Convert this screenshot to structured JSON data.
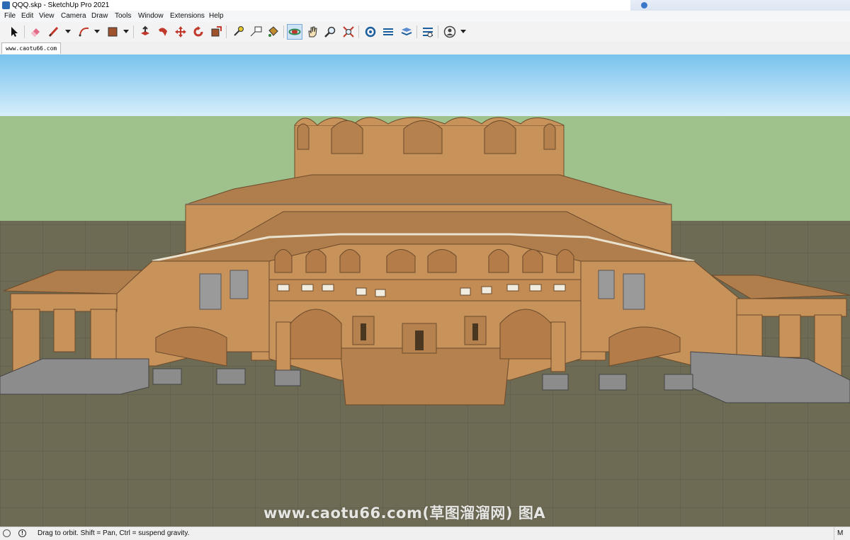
{
  "window": {
    "title": "QQQ.skp - SketchUp Pro 2021"
  },
  "menu": [
    "File",
    "Edit",
    "View",
    "Camera",
    "Draw",
    "Tools",
    "Window",
    "Extensions",
    "Help"
  ],
  "toolbar": {
    "tools": [
      {
        "name": "select-icon"
      },
      {
        "name": "eraser-icon"
      },
      {
        "name": "line-icon"
      },
      {
        "name": "arc-icon"
      },
      {
        "name": "rectangle-icon"
      },
      {
        "name": "push-pull-icon"
      },
      {
        "name": "follow-me-icon"
      },
      {
        "name": "move-icon"
      },
      {
        "name": "rotate-icon"
      },
      {
        "name": "scale-icon"
      },
      {
        "name": "tape-measure-icon"
      },
      {
        "name": "text-icon"
      },
      {
        "name": "paint-bucket-icon"
      },
      {
        "name": "orbit-icon",
        "active": true
      },
      {
        "name": "pan-icon"
      },
      {
        "name": "zoom-icon"
      },
      {
        "name": "zoom-extents-icon"
      },
      {
        "name": "3d-warehouse-icon"
      },
      {
        "name": "extension-warehouse-icon"
      },
      {
        "name": "layout-icon"
      },
      {
        "name": "extension-manager-icon"
      },
      {
        "name": "account-icon"
      }
    ]
  },
  "scene_tab": {
    "label": "www.caotu66.com"
  },
  "viewport": {
    "sky_color": "#86cbf0",
    "horizon_color": "#9fc18c",
    "ground_color": "#6f6c56",
    "building_color": "#c8935b",
    "roof_color": "#b07d4c"
  },
  "watermark": "www.caotu66.com(草图溜溜网) 图A",
  "statusbar": {
    "message": "Drag to orbit. Shift = Pan, Ctrl = suspend gravity.",
    "measurements_label": "M"
  }
}
